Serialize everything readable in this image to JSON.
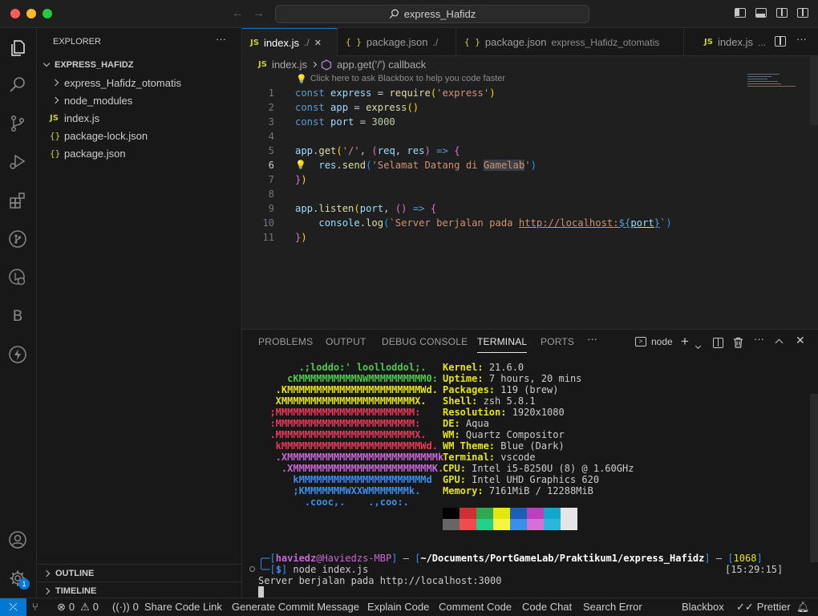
{
  "titlebar": {
    "search_text": "express_Hafidz"
  },
  "explorer": {
    "header": "EXPLORER",
    "more": "···",
    "root": "EXPRESS_HAFIDZ",
    "items": [
      {
        "label": "express_Hafidz_otomatis",
        "kind": "folder"
      },
      {
        "label": "node_modules",
        "kind": "folder"
      },
      {
        "label": "index.js",
        "kind": "js"
      },
      {
        "label": "package-lock.json",
        "kind": "json"
      },
      {
        "label": "package.json",
        "kind": "json"
      }
    ],
    "outline": "OUTLINE",
    "timeline": "TIMELINE"
  },
  "tabs": [
    {
      "icon": "JS",
      "label": "index.js",
      "desc": "./",
      "close": "✕",
      "active": true
    },
    {
      "icon": "{ }",
      "label": "package.json",
      "desc": "./"
    },
    {
      "icon": "{ }",
      "label": "package.json",
      "desc": "express_Hafidz_otomatis"
    },
    {
      "icon": "JS",
      "label": "index.js",
      "desc": "..."
    }
  ],
  "breadcrumb": {
    "file": "index.js",
    "symbol": "app.get('/') callback"
  },
  "editor": {
    "hint": "Click here to ask Blackbox to help you code faster",
    "current_line": 6,
    "line_numbers": [
      "1",
      "2",
      "3",
      "4",
      "5",
      "6",
      "7",
      "8",
      "9",
      "10",
      "11"
    ]
  },
  "panel": {
    "tabs": [
      "PROBLEMS",
      "OUTPUT",
      "DEBUG CONSOLE",
      "TERMINAL",
      "PORTS"
    ],
    "active_tab": "TERMINAL",
    "more": "···",
    "terminal_name": "node"
  },
  "terminal": {
    "logo_lines": [
      "       .;loddo:' loolloddol;.",
      "     cKMMMMMMMMMMNWMMMMMMMMMM0:",
      "   .KMMMMMMMMMMMMMMMMMMMMMMMWd.",
      "   XMMMMMMMMMMMMMMMMMMMMMMMX.",
      "  ;MMMMMMMMMMMMMMMMMMMMMMMM:",
      "  :MMMMMMMMMMMMMMMMMMMMMMMM:",
      "  .MMMMMMMMMMMMMMMMMMMMMMMMX.",
      "   kMMMMMMMMMMMMMMMMMMMMMMMMWd.",
      "   .XMMMMMMMMMMMMMMMMMMMMMMMMMMk",
      "    .XMMMMMMMMMMMMMMMMMMMMMMMMK.",
      "      kMMMMMMMMMMMMMMMMMMMMMMd",
      "      ;KMMMMMMMWXXWMMMMMMMk.",
      "        .cooc,.    .,coo:."
    ],
    "logo_colors": [
      "#4ec94e",
      "#4ec94e",
      "#e5e510",
      "#e5e510",
      "#e8385a",
      "#e8385a",
      "#e8385a",
      "#e8385a",
      "#c567d4",
      "#c567d4",
      "#3b8eea",
      "#3b8eea",
      "#3b8eea"
    ],
    "info": [
      {
        "key": "Kernel",
        "value": "21.6.0"
      },
      {
        "key": "Uptime",
        "value": "7 hours, 20 mins"
      },
      {
        "key": "Packages",
        "value": "119 (brew)"
      },
      {
        "key": "Shell",
        "value": "zsh 5.8.1"
      },
      {
        "key": "Resolution",
        "value": "1920x1080"
      },
      {
        "key": "DE",
        "value": "Aqua"
      },
      {
        "key": "WM",
        "value": "Quartz Compositor"
      },
      {
        "key": "WM Theme",
        "value": "Blue (Dark)"
      },
      {
        "key": "Terminal",
        "value": "vscode"
      },
      {
        "key": "CPU",
        "value": "Intel i5-8250U (8) @ 1.60GHz"
      },
      {
        "key": "GPU",
        "value": "Intel UHD Graphics 620"
      },
      {
        "key": "Memory",
        "value": "7161MiB / 12288MiB"
      }
    ],
    "palette_top": [
      "#000000",
      "#cd3131",
      "#2fa84f",
      "#e5e510",
      "#1a5fb4",
      "#bc3fbc",
      "#11a8cd",
      "#e5e5e5"
    ],
    "palette_bottom": [
      "#666666",
      "#f14c4c",
      "#23d18b",
      "#f5f543",
      "#3b8eea",
      "#d670d6",
      "#29b8db",
      "#e5e5e5"
    ],
    "prompt_user": "haviedz",
    "prompt_host": "@Haviedzs-MBP",
    "prompt_path": "~/Documents/PortGameLab/Praktikum1/express_Hafidz",
    "prompt_count": "1068",
    "command": "node index.js",
    "time": "[15:29:15]",
    "output": "Server berjalan pada http://localhost:3000"
  },
  "statusbar": {
    "errors": "0",
    "warnings": "0",
    "ports": "0",
    "items": [
      "Share Code Link",
      "Generate Commit Message",
      "Explain Code",
      "Comment Code",
      "Code Chat",
      "Search Error"
    ],
    "blackbox": "Blackbox",
    "prettier": "Prettier",
    "badge": "1"
  }
}
